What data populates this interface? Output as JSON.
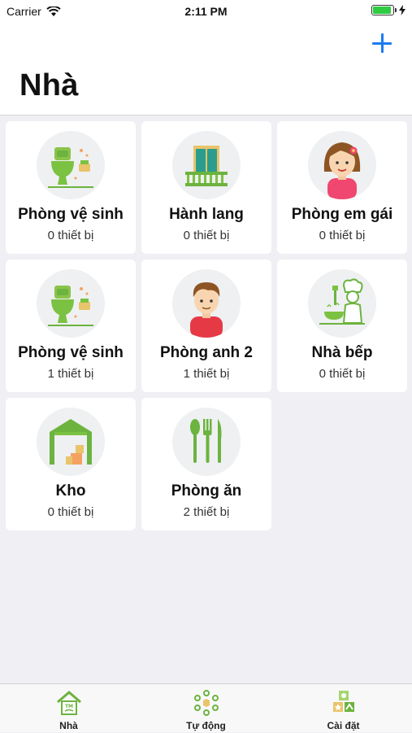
{
  "status_bar": {
    "carrier": "Carrier",
    "time": "2:11 PM",
    "battery_level": 0.9
  },
  "nav": {
    "title": "Nhà",
    "add_icon": "plus-icon"
  },
  "rooms": [
    {
      "name": "Phòng vệ sinh",
      "count": "0 thiết bị",
      "icon": "toilet-icon"
    },
    {
      "name": "Hành lang",
      "count": "0 thiết bị",
      "icon": "balcony-icon"
    },
    {
      "name": "Phòng em gái",
      "count": "0 thiết bị",
      "icon": "girl-avatar-icon"
    },
    {
      "name": "Phòng vệ sinh",
      "count": "1 thiết bị",
      "icon": "toilet-icon"
    },
    {
      "name": "Phòng anh 2",
      "count": "1 thiết bị",
      "icon": "boy-avatar-icon"
    },
    {
      "name": "Nhà bếp",
      "count": "0 thiết bị",
      "icon": "chef-icon"
    },
    {
      "name": "Kho",
      "count": "0 thiết bị",
      "icon": "warehouse-icon"
    },
    {
      "name": "Phòng ăn",
      "count": "2 thiết bị",
      "icon": "cutlery-icon"
    }
  ],
  "tabs": [
    {
      "label": "Nhà",
      "icon": "home-icon"
    },
    {
      "label": "Tự động",
      "icon": "automation-icon"
    },
    {
      "label": "Cài đặt",
      "icon": "settings-icon"
    }
  ],
  "colors": {
    "accent": "#1a7cf2",
    "green": "#6cb33f",
    "background": "#efeff4"
  }
}
